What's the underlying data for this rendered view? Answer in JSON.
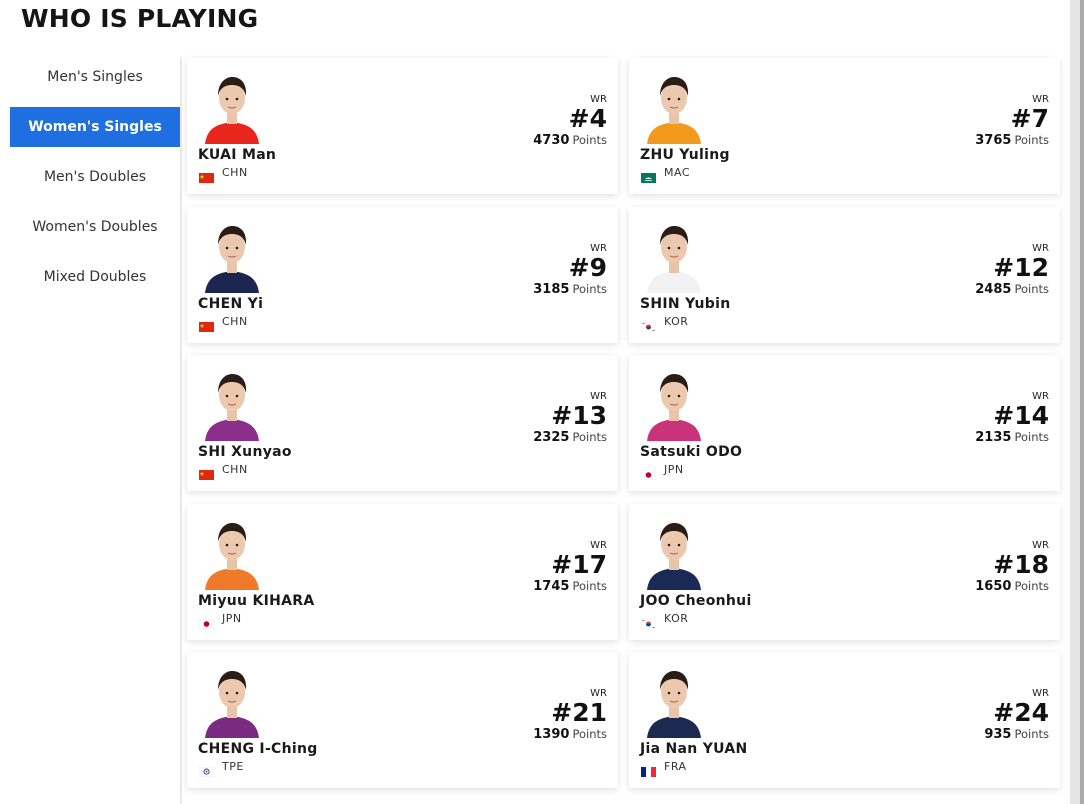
{
  "page": {
    "title": "WHO IS PLAYING"
  },
  "sidebar": {
    "items": [
      {
        "label": "Men's Singles",
        "active": false
      },
      {
        "label": "Women's Singles",
        "active": true
      },
      {
        "label": "Men's Doubles",
        "active": false
      },
      {
        "label": "Women's Doubles",
        "active": false
      },
      {
        "label": "Mixed Doubles",
        "active": false
      }
    ],
    "active_color": "#1f6fe0"
  },
  "players": [
    {
      "name": "KUAI Man",
      "country": "CHN",
      "wr_label": "WR",
      "rank": "#4",
      "points": "4730",
      "points_label": "Points",
      "jersey_color": "#e8261c",
      "flag": "chn"
    },
    {
      "name": "ZHU Yuling",
      "country": "MAC",
      "wr_label": "WR",
      "rank": "#7",
      "points": "3765",
      "points_label": "Points",
      "jersey_color": "#f39a1e",
      "flag": "mac"
    },
    {
      "name": "CHEN Yi",
      "country": "CHN",
      "wr_label": "WR",
      "rank": "#9",
      "points": "3185",
      "points_label": "Points",
      "jersey_color": "#1c2450",
      "flag": "chn"
    },
    {
      "name": "SHIN Yubin",
      "country": "KOR",
      "wr_label": "WR",
      "rank": "#12",
      "points": "2485",
      "points_label": "Points",
      "jersey_color": "#f2f2f4",
      "flag": "kor"
    },
    {
      "name": "SHI Xunyao",
      "country": "CHN",
      "wr_label": "WR",
      "rank": "#13",
      "points": "2325",
      "points_label": "Points",
      "jersey_color": "#8a2f8c",
      "flag": "chn"
    },
    {
      "name": "Satsuki ODO",
      "country": "JPN",
      "wr_label": "WR",
      "rank": "#14",
      "points": "2135",
      "points_label": "Points",
      "jersey_color": "#c8337a",
      "flag": "jpn"
    },
    {
      "name": "Miyuu KIHARA",
      "country": "JPN",
      "wr_label": "WR",
      "rank": "#17",
      "points": "1745",
      "points_label": "Points",
      "jersey_color": "#ee7a2a",
      "flag": "jpn"
    },
    {
      "name": "JOO Cheonhui",
      "country": "KOR",
      "wr_label": "WR",
      "rank": "#18",
      "points": "1650",
      "points_label": "Points",
      "jersey_color": "#1b2a55",
      "flag": "kor"
    },
    {
      "name": "CHENG I-Ching",
      "country": "TPE",
      "wr_label": "WR",
      "rank": "#21",
      "points": "1390",
      "points_label": "Points",
      "jersey_color": "#7a2a80",
      "flag": "tpe"
    },
    {
      "name": "Jia Nan YUAN",
      "country": "FRA",
      "wr_label": "WR",
      "rank": "#24",
      "points": "935",
      "points_label": "Points",
      "jersey_color": "#1c2a52",
      "flag": "fra"
    }
  ]
}
